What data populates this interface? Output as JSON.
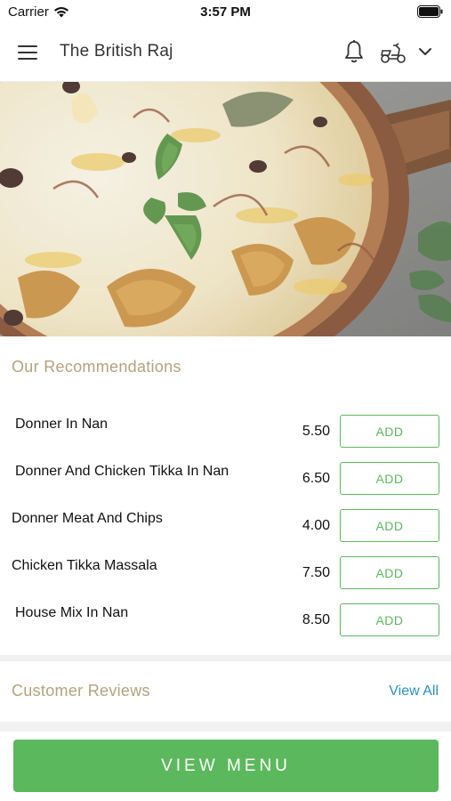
{
  "status_bar": {
    "carrier": "Carrier",
    "time": "3:57 PM",
    "icons": [
      "wifi-icon",
      "battery-icon"
    ]
  },
  "header": {
    "title": "The British Raj",
    "icons": [
      "hamburger-menu-icon",
      "bell-icon",
      "scooter-icon",
      "chevron-down-icon"
    ]
  },
  "hero": {
    "image": "biryani-dish-photo"
  },
  "recommendations": {
    "title": "Our Recommendations",
    "items": [
      {
        "name": "Donner In Nan",
        "price": "5.50",
        "add_label": "ADD"
      },
      {
        "name": "Donner And Chicken Tikka In Nan",
        "price": "6.50",
        "add_label": "ADD"
      },
      {
        "name": "Donner Meat And Chips",
        "price": "4.00",
        "add_label": "ADD"
      },
      {
        "name": "Chicken Tikka Massala",
        "price": "7.50",
        "add_label": "ADD"
      },
      {
        "name": "House Mix In Nan",
        "price": "8.50",
        "add_label": "ADD"
      }
    ]
  },
  "reviews": {
    "title": "Customer Reviews",
    "view_all_label": "View All"
  },
  "bottom": {
    "view_menu_label": "VIEW MENU"
  },
  "colors": {
    "accent_green": "#5cb85c",
    "section_title": "#b3a37e",
    "link_blue": "#2a8fbd"
  }
}
